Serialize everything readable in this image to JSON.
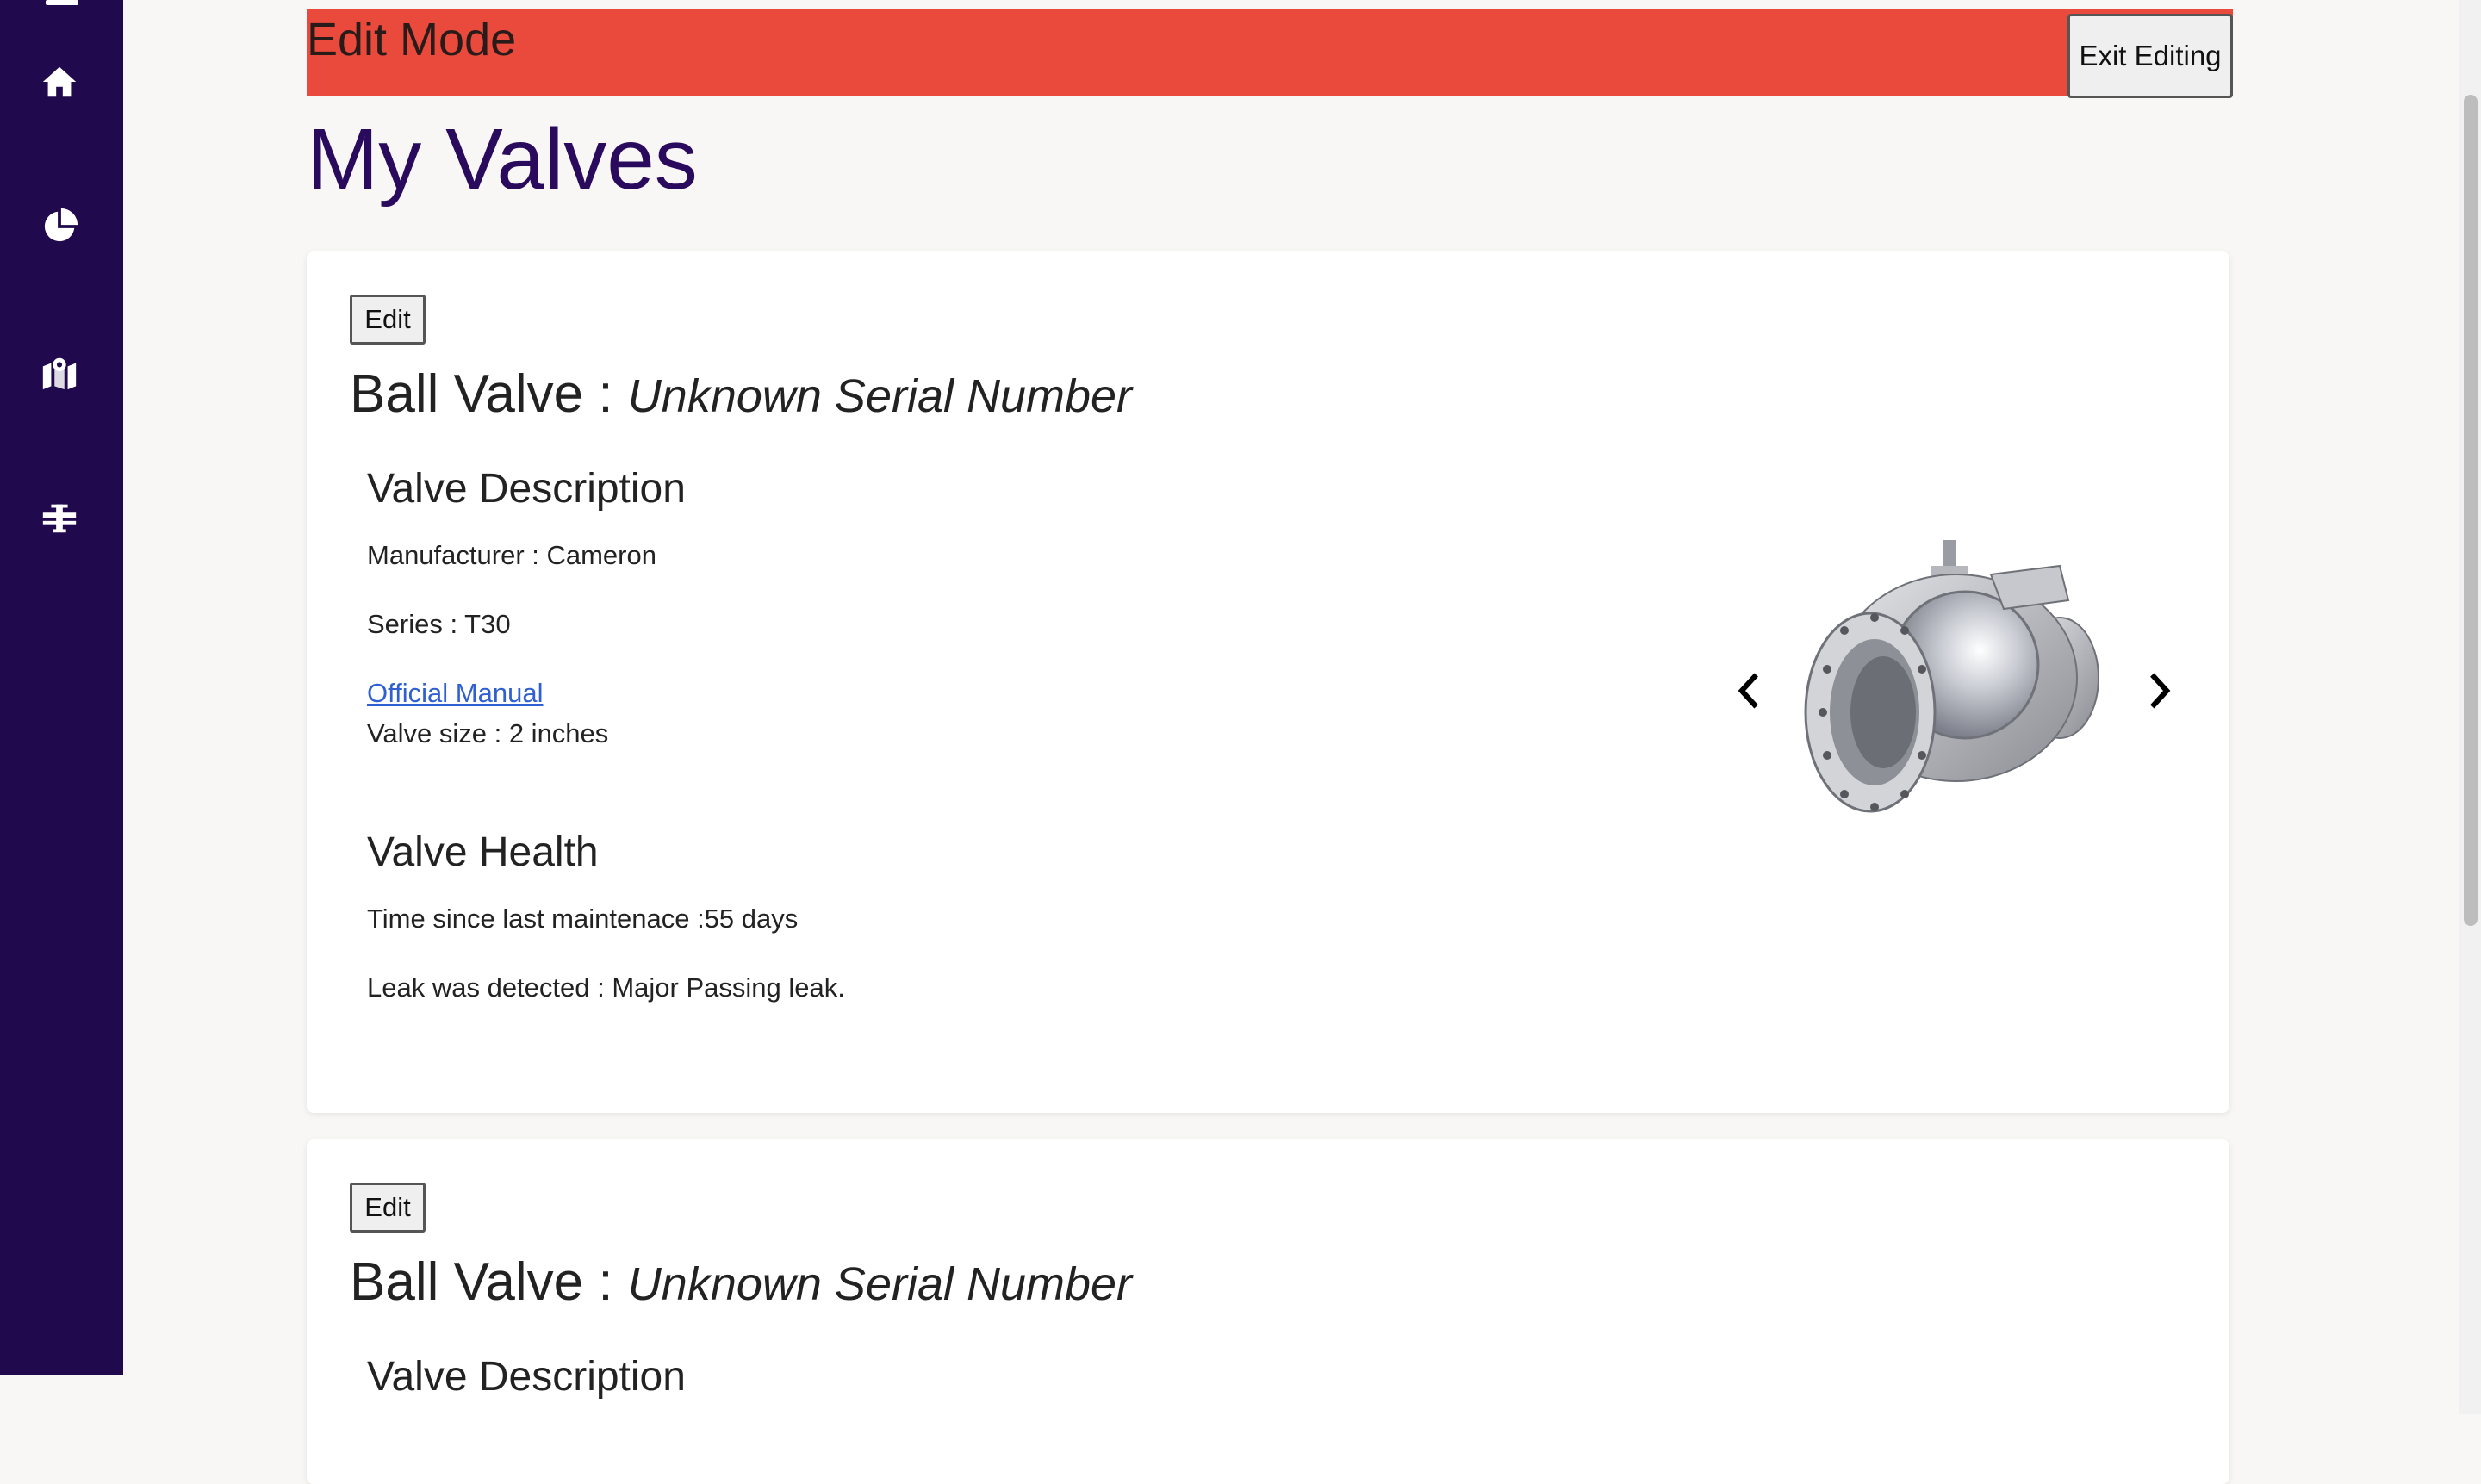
{
  "banner": {
    "title": "Edit Mode",
    "exit_label": "Exit Editing",
    "color": "#e94a3b"
  },
  "page": {
    "title": "My Valves"
  },
  "sidebar": {
    "color": "#21094e",
    "icons": [
      "menu-icon",
      "home-icon",
      "pie-chart-icon",
      "map-icon",
      "pipeline-icon"
    ]
  },
  "valves": [
    {
      "edit_label": "Edit",
      "type": "Ball Valve",
      "separator": " : ",
      "serial": "Unknown Serial Number",
      "description": {
        "heading": "Valve Description",
        "manufacturer": "Manufacturer : Cameron",
        "series": "Series : T30",
        "manual_link": "Official Manual",
        "size": "Valve size : 2 inches"
      },
      "health": {
        "heading": "Valve Health",
        "maintenance": "Time since last maintenace :55 days",
        "leak": "Leak was detected : Major Passing leak."
      }
    },
    {
      "edit_label": "Edit",
      "type": "Ball Valve",
      "separator": " : ",
      "serial": "Unknown Serial Number",
      "description": {
        "heading": "Valve Description"
      }
    }
  ]
}
